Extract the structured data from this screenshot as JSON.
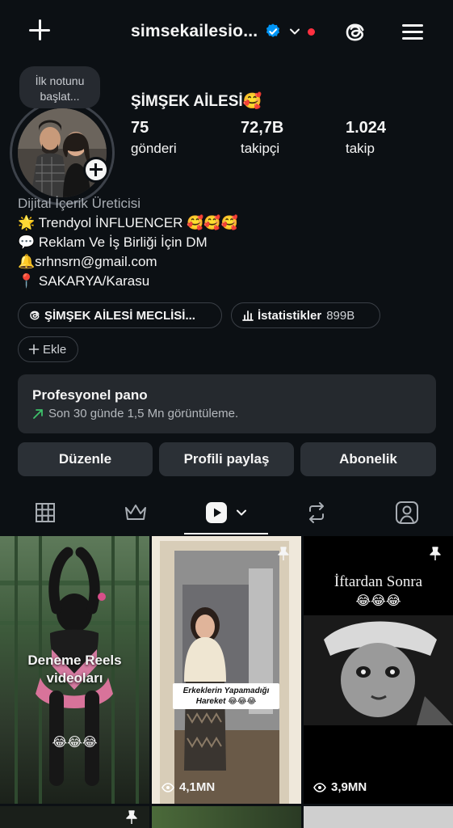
{
  "header": {
    "username": "simsekailesio...",
    "icons": [
      "plus-icon",
      "verified-badge-icon",
      "chevron-down-icon",
      "threads-icon",
      "menu-icon"
    ]
  },
  "profile": {
    "note": "İlk notunu başlat...",
    "display_name": "ŞİMŞEK AİLESİ🥰",
    "stats": [
      {
        "value": "75",
        "label": "gönderi"
      },
      {
        "value": "72,7B",
        "label": "takipçi"
      },
      {
        "value": "1.024",
        "label": "takip"
      }
    ]
  },
  "bio": {
    "category": "Dijital İçerik Üreticisi",
    "lines": [
      "🌟 Trendyol İNFLUENCER 🥰🥰🥰",
      "💬 Reklam Ve İş Birliği İçin DM",
      "🔔srhnsrn@gmail.com",
      "📍 SAKARYA/Karasu"
    ]
  },
  "chips": {
    "threads_link": "ŞİMŞEK AİLESİ MECLİSİ...",
    "insights_label": "İstatistikler",
    "insights_count": "899B",
    "add_label": "Ekle"
  },
  "pro_panel": {
    "title": "Profesyonel pano",
    "subtitle": "Son 30 günde 1,5 Mn görüntüleme."
  },
  "actions": {
    "edit": "Düzenle",
    "share": "Profili paylaş",
    "subscription": "Abonelik"
  },
  "tabs": [
    "grid-icon",
    "crown-icon",
    "reels-icon",
    "reposts-icon",
    "tagged-icon"
  ],
  "posts": [
    {
      "caption": "Deneme Reels videoları",
      "emoji": "😂😂😂",
      "views": ""
    },
    {
      "caption": "Erkeklerin Yapamadığı Hareket 😂😂😂",
      "views": "4,1MN",
      "pinned": true
    },
    {
      "caption": "İftardan Sonra",
      "emoji": "😂😂😂",
      "views": "3,9MN",
      "pinned": true
    }
  ],
  "colors": {
    "background": "#0c1014",
    "button": "#2b3036",
    "panel": "#25292e",
    "verified": "#0095f6",
    "notification": "#ff3040",
    "trend_up": "#3ec06a"
  }
}
